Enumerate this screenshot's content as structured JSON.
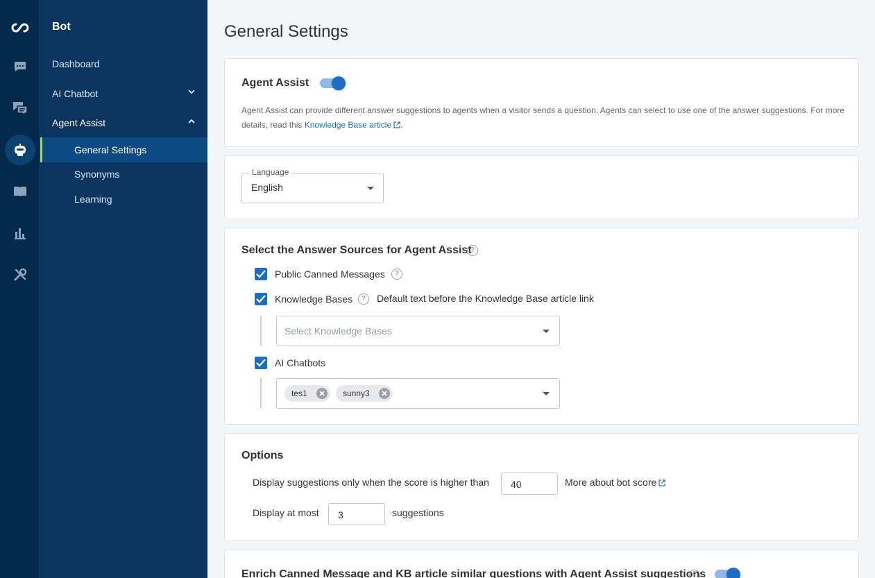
{
  "rail": {
    "icons": [
      "infinity-logo-icon",
      "chat-icon",
      "messages-icon",
      "bot-icon",
      "book-icon",
      "bar-chart-icon",
      "tools-icon"
    ]
  },
  "nav": {
    "title": "Bot",
    "items": [
      {
        "label": "Dashboard"
      },
      {
        "label": "AI Chatbot"
      },
      {
        "label": "Agent Assist"
      }
    ],
    "sub_items": [
      {
        "label": "General Settings"
      },
      {
        "label": "Synonyms"
      },
      {
        "label": "Learning"
      }
    ]
  },
  "page": {
    "title": "General Settings"
  },
  "agent_assist": {
    "title": "Agent Assist",
    "enabled": true,
    "description": "Agent Assist can provide different answer suggestions to agents when a visitor sends a question. Agents can select to use one of the answer suggestions. For more details, read this ",
    "link_text": "Knowledge Base article",
    "description_end": "."
  },
  "language": {
    "label": "Language",
    "value": "English"
  },
  "sources": {
    "title": "Select the Answer Sources for Agent Assist",
    "public_canned": {
      "label": "Public Canned Messages",
      "checked": true
    },
    "knowledge_bases": {
      "label": "Knowledge Bases",
      "checked": true,
      "link_text": "Default text before the Knowledge Base article link",
      "placeholder": "Select Knowledge Bases"
    },
    "ai_chatbots": {
      "label": "AI Chatbots",
      "checked": true,
      "chips": [
        "tes1",
        "sunny3"
      ]
    }
  },
  "options": {
    "title": "Options",
    "score_label": "Display suggestions only when the score is higher than",
    "score_value": "40",
    "score_link": "More about bot score",
    "atmost_label": "Display at most",
    "atmost_value": "3",
    "atmost_suffix": "suggestions"
  },
  "enrich": {
    "title": "Enrich Canned Message and KB article similar questions with Agent Assist suggestions",
    "enabled": true
  },
  "colors": {
    "rail_bg": "#03294d",
    "nav_bg": "#0a3560",
    "accent": "#1a6fc4",
    "active_marker": "#a9d25d"
  }
}
